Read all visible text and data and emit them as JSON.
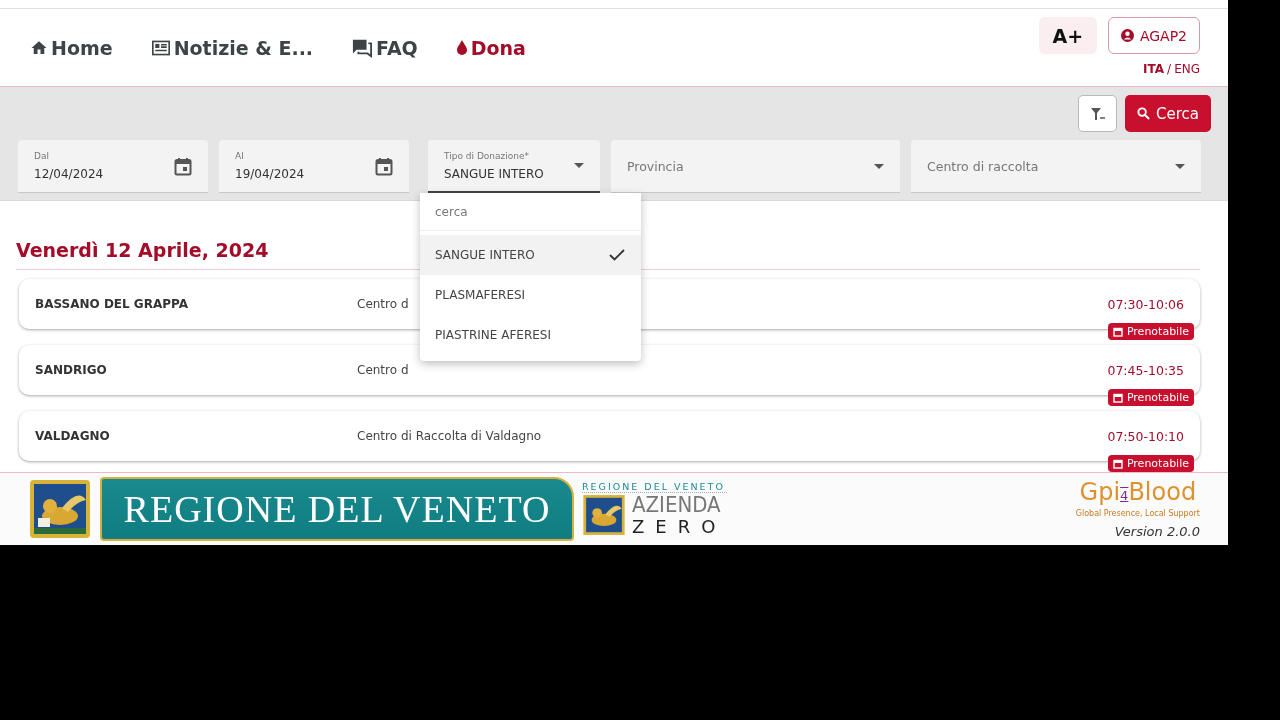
{
  "nav": {
    "items": [
      {
        "label": "Home",
        "selected": false
      },
      {
        "label": "Notizie & E...",
        "selected": false
      },
      {
        "label": "FAQ",
        "selected": false
      },
      {
        "label": "Dona",
        "selected": true
      }
    ]
  },
  "font_size_button": "A+",
  "user_button": "AGAP2",
  "languages": [
    {
      "label": "ITA",
      "selected": true
    },
    {
      "label": "ENG",
      "selected": false
    }
  ],
  "language_separator": "/",
  "search_button": "Cerca",
  "fields": [
    {
      "kind": "date",
      "label": "Dal",
      "value": "12/04/2024"
    },
    {
      "kind": "date",
      "label": "Al",
      "value": "19/04/2024"
    },
    {
      "kind": "select",
      "label": "Tipo di Donazione*",
      "value": "SANGUE INTERO",
      "expanded": true
    },
    {
      "kind": "select",
      "placeholder": "Provincia",
      "expanded": false
    },
    {
      "kind": "select",
      "placeholder": "Centro di raccolta",
      "expanded": false
    }
  ],
  "dropdown": {
    "search_placeholder": "cerca",
    "options": [
      {
        "label": "SANGUE INTERO",
        "selected": true
      },
      {
        "label": "PLASMAFERESI",
        "selected": false
      },
      {
        "label": "PIASTRINE AFERESI",
        "selected": false
      }
    ]
  },
  "day_heading": "Venerdì 12 Aprile, 2024",
  "rows": [
    {
      "name": "BASSANO DEL GRAPPA",
      "center": "Centro d",
      "time": "07:30-10:06",
      "badge": "Prenotabile"
    },
    {
      "name": "SANDRIGO",
      "center": "Centro d",
      "time": "07:45-10:35",
      "badge": "Prenotabile"
    },
    {
      "name": "VALDAGNO",
      "center": "Centro di Raccolta di Valdagno",
      "time": "07:50-10:10",
      "badge": "Prenotabile"
    }
  ],
  "footer": {
    "banner_title": "REGIONE DEL VENETO",
    "agency_region": "REGIONE DEL VENETO",
    "agency_name": "AZIENDA",
    "agency_suffix": "ZERO",
    "brand_start": "Gpi",
    "brand_digit": "4",
    "brand_end": "Blood",
    "brand_tagline": "Global Presence, Local Support",
    "version": "Version 2.0.0"
  }
}
